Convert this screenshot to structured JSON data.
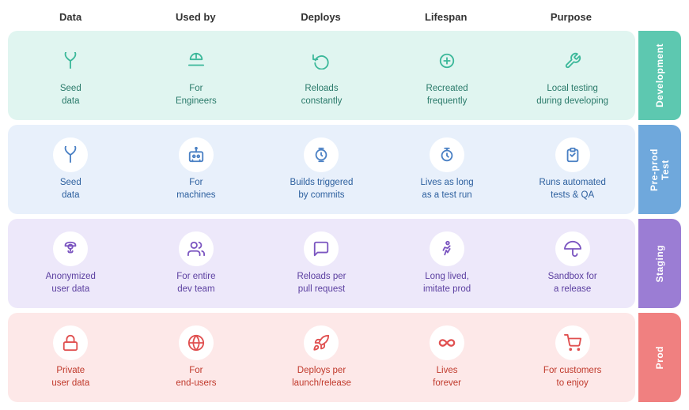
{
  "header": {
    "columns": [
      "Data",
      "Used by",
      "Deploys",
      "Lifespan",
      "Purpose"
    ]
  },
  "rows": [
    {
      "id": "development",
      "env": "Development",
      "envColor": "#5dc8b0",
      "bgColor": "#e0f5f0",
      "textColor": "#2a7a6a",
      "iconColor": "#3cb89a",
      "cells": [
        {
          "icon": "🌱",
          "label": "Seed\ndata"
        },
        {
          "icon": "👷",
          "label": "For\nEngineers"
        },
        {
          "icon": "🔄",
          "label": "Reloads\nconstantly"
        },
        {
          "icon": "➕",
          "label": "Recreated\nfrequently"
        },
        {
          "icon": "🔧",
          "label": "Local testing\nduring developing"
        }
      ]
    },
    {
      "id": "test",
      "env": "Pre-prod\nTest",
      "envColor": "#6fa8dc",
      "bgColor": "#e8f0fb",
      "textColor": "#2c5f9e",
      "iconColor": "#4a80c4",
      "cells": [
        {
          "icon": "🌱",
          "label": "Seed\ndata"
        },
        {
          "icon": "🤖",
          "label": "For\nmachines"
        },
        {
          "icon": "⌚",
          "label": "Builds triggered\nby commits"
        },
        {
          "icon": "⏱",
          "label": "Lives as long\nas a test run"
        },
        {
          "icon": "📋",
          "label": "Runs automated\ntests & QA"
        }
      ]
    },
    {
      "id": "staging",
      "env": "Staging",
      "envColor": "#9b7dd4",
      "bgColor": "#ede8fa",
      "textColor": "#5b3fa0",
      "iconColor": "#7b55c0",
      "cells": [
        {
          "icon": "🕵️",
          "label": "Anonymized\nuser data"
        },
        {
          "icon": "👥",
          "label": "For entire\ndev team"
        },
        {
          "icon": "💬",
          "label": "Reloads per\npull request"
        },
        {
          "icon": "🚶",
          "label": "Long lived,\nimitate prod"
        },
        {
          "icon": "☂️",
          "label": "Sandbox for\na release"
        }
      ]
    },
    {
      "id": "prod",
      "env": "Prod",
      "envColor": "#f08080",
      "bgColor": "#fde8e8",
      "textColor": "#c0392b",
      "iconColor": "#e05050",
      "cells": [
        {
          "icon": "🔒",
          "label": "Private\nuser data"
        },
        {
          "icon": "🌐",
          "label": "For\nend-users"
        },
        {
          "icon": "🚀",
          "label": "Deploys per\nlaunch/release"
        },
        {
          "icon": "♾️",
          "label": "Lives\nforever"
        },
        {
          "icon": "🛒",
          "label": "For customers\nto enjoy"
        }
      ]
    }
  ]
}
